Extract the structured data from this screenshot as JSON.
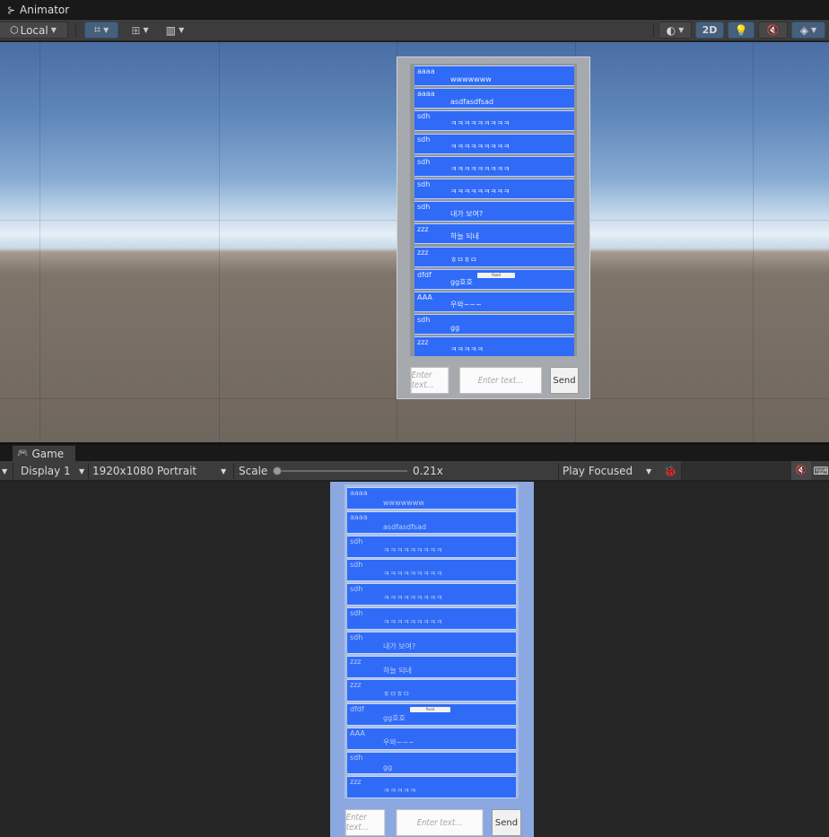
{
  "animator": {
    "tab_label": "Animator"
  },
  "scene_toolbar": {
    "pivot_label": "Local",
    "toggle_2d_label": "2D"
  },
  "chat": {
    "rows": [
      {
        "name": "aaaa",
        "message": "wwwwwww"
      },
      {
        "name": "aaaa",
        "message": "asdfasdfsad"
      },
      {
        "name": "sdh",
        "message": "ㅋㅋㅋㅋㅋㅋㅋㅋㅋ"
      },
      {
        "name": "sdh",
        "message": "ㅋㅋㅋㅋㅋㅋㅋㅋㅋ"
      },
      {
        "name": "sdh",
        "message": "ㅋㅋㅋㅋㅋㅋㅋㅋㅋ"
      },
      {
        "name": "sdh",
        "message": "ㅋㅋㅋㅋㅋㅋㅋㅋㅋ"
      },
      {
        "name": "sdh",
        "message": "내가 보여?"
      },
      {
        "name": "zzz",
        "message": "하늘 되네"
      },
      {
        "name": "zzz",
        "message": "ㅎㅁㅎㅁ"
      },
      {
        "name": "dfdf",
        "message": "gg호호",
        "button_label": "fixed"
      },
      {
        "name": "AAA",
        "message": "우와~~~"
      },
      {
        "name": "sdh",
        "message": "gg"
      },
      {
        "name": "zzz",
        "message": "ㅋㅋㅋㅋㅋ"
      }
    ],
    "name_input_placeholder": "Enter text...",
    "message_input_placeholder": "Enter text...",
    "send_label": "Send"
  },
  "game": {
    "tab_label": "Game",
    "display_label": "Display 1",
    "resolution_label": "1920x1080 Portrait",
    "scale_label": "Scale",
    "scale_value_label": "0.21x",
    "scale_fraction": 0.0,
    "play_mode_label": "Play Focused"
  },
  "colors": {
    "row_blue": "#2f6bf7",
    "toolbar_active": "#46607c"
  }
}
